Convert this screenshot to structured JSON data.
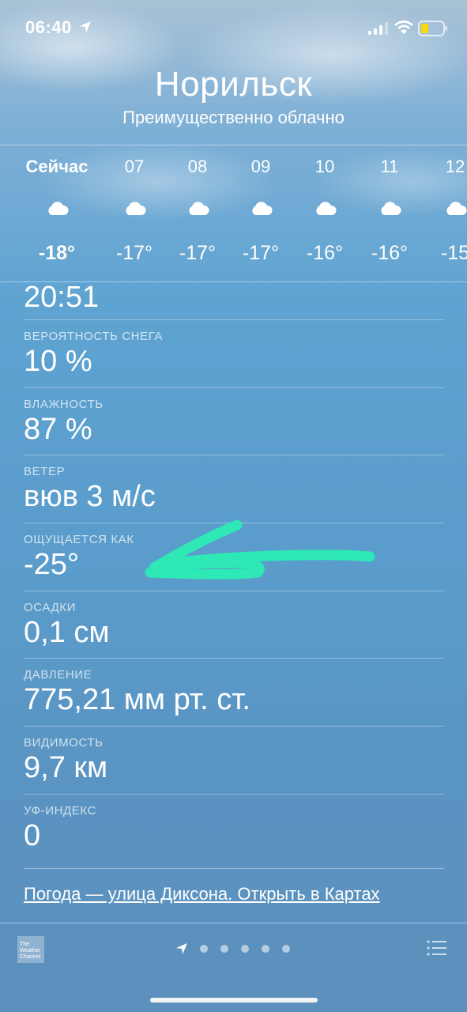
{
  "status_bar": {
    "time": "06:40",
    "location_icon": "location-arrow-icon",
    "signal_icon": "cellular-signal-icon",
    "wifi_icon": "wifi-icon",
    "battery_icon": "battery-icon",
    "battery_color": "#f5d90a"
  },
  "header": {
    "city": "Норильск",
    "condition": "Преимущественно облачно"
  },
  "hourly": [
    {
      "label": "Сейчас",
      "icon": "cloud-icon",
      "temp": "-18°"
    },
    {
      "label": "07",
      "icon": "cloud-icon",
      "temp": "-17°"
    },
    {
      "label": "08",
      "icon": "cloud-icon",
      "temp": "-17°"
    },
    {
      "label": "09",
      "icon": "cloud-icon",
      "temp": "-17°"
    },
    {
      "label": "10",
      "icon": "cloud-icon",
      "temp": "-16°"
    },
    {
      "label": "11",
      "icon": "cloud-icon",
      "temp": "-16°"
    },
    {
      "label": "12",
      "icon": "cloud-icon",
      "temp": "-15"
    }
  ],
  "details": {
    "partial_value": "20:51",
    "rows": [
      {
        "label": "ВЕРОЯТНОСТЬ СНЕГА",
        "value": "10 %"
      },
      {
        "label": "ВЛАЖНОСТЬ",
        "value": "87 %"
      },
      {
        "label": "ВЕТЕР",
        "value": "вюв 3 м/с"
      },
      {
        "label": "ОЩУЩАЕТСЯ КАК",
        "value": "-25°"
      },
      {
        "label": "ОСАДКИ",
        "value": "0,1 см"
      },
      {
        "label": "ДАВЛЕНИЕ",
        "value": "775,21 мм рт. ст."
      },
      {
        "label": "ВИДИМОСТЬ",
        "value": "9,7 км"
      },
      {
        "label": "УФ-ИНДЕКС",
        "value": "0"
      }
    ]
  },
  "link_text": "Погода — улица Диксона. Открыть в Картах",
  "footer": {
    "provider_logo": "The Weather Channel",
    "page_count": 5,
    "current_page": "location",
    "list_icon": "list-icon"
  },
  "annotation": {
    "arrow_color": "#2ee8b6"
  }
}
